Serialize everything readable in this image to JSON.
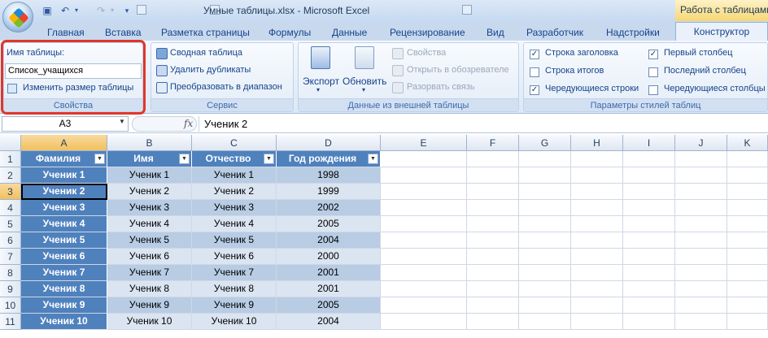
{
  "window": {
    "title": "Умные таблицы.xlsx - Microsoft Excel",
    "context_tab_title": "Работа с таблицами"
  },
  "ribbon_tabs": [
    "Главная",
    "Вставка",
    "Разметка страницы",
    "Формулы",
    "Данные",
    "Рецензирование",
    "Вид",
    "Разработчик",
    "Надстройки"
  ],
  "active_tab": "Конструктор",
  "groups": {
    "properties": {
      "label": "Свойства",
      "table_name_label": "Имя таблицы:",
      "table_name_value": "Список_учащихся",
      "resize_label": "Изменить размер таблицы"
    },
    "service": {
      "label": "Сервис",
      "pivot": "Сводная таблица",
      "remove_dup": "Удалить дубликаты",
      "convert": "Преобразовать в диапазон"
    },
    "external": {
      "label": "Данные из внешней таблицы",
      "export": "Экспорт",
      "refresh": "Обновить",
      "props": "Свойства",
      "open_browser": "Открыть в обозревателе",
      "unlink": "Разорвать связь"
    },
    "style_options": {
      "label": "Параметры стилей таблиц",
      "header_row": "Строка заголовка",
      "totals_row": "Строка итогов",
      "banded_rows": "Чередующиеся строки",
      "first_col": "Первый столбец",
      "last_col": "Последний столбец",
      "banded_cols": "Чередующиеся столбцы",
      "header_row_checked": true,
      "totals_row_checked": false,
      "banded_rows_checked": true,
      "first_col_checked": true,
      "last_col_checked": false,
      "banded_cols_checked": false
    }
  },
  "formula_bar": {
    "name_box": "A3",
    "fx": "fx",
    "value": "Ученик 2"
  },
  "columns": [
    "A",
    "B",
    "C",
    "D",
    "E",
    "F",
    "G",
    "H",
    "I",
    "J",
    "K"
  ],
  "rows": [
    "1",
    "2",
    "3",
    "4",
    "5",
    "6",
    "7",
    "8",
    "9",
    "10",
    "11"
  ],
  "table": {
    "headers": [
      "Фамилия",
      "Имя",
      "Отчество",
      "Год рождения"
    ],
    "data": [
      [
        "Ученик 1",
        "Ученик 1",
        "Ученик 1",
        "1998"
      ],
      [
        "Ученик 2",
        "Ученик 2",
        "Ученик 2",
        "1999"
      ],
      [
        "Ученик 3",
        "Ученик 3",
        "Ученик 3",
        "2002"
      ],
      [
        "Ученик 4",
        "Ученик 4",
        "Ученик 4",
        "2005"
      ],
      [
        "Ученик 5",
        "Ученик 5",
        "Ученик 5",
        "2004"
      ],
      [
        "Ученик 6",
        "Ученик 6",
        "Ученик 6",
        "2000"
      ],
      [
        "Ученик 7",
        "Ученик 7",
        "Ученик 7",
        "2001"
      ],
      [
        "Ученик 8",
        "Ученик 8",
        "Ученик 8",
        "2001"
      ],
      [
        "Ученик 9",
        "Ученик 9",
        "Ученик 9",
        "2005"
      ],
      [
        "Ученик 10",
        "Ученик 10",
        "Ученик 10",
        "2004"
      ]
    ]
  },
  "colors": {
    "header_fill": "#4f81bd",
    "band_light": "#dbe5f1",
    "band_dark": "#b8cce4",
    "highlight_border": "#e0362a"
  }
}
